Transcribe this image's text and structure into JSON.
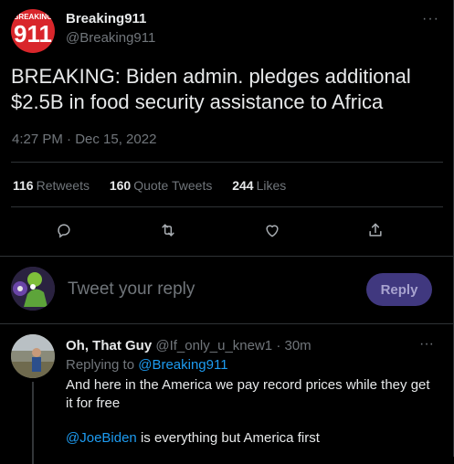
{
  "tweet": {
    "author": {
      "name": "Breaking911",
      "handle": "@Breaking911",
      "avatar_top_text": "BREAKING",
      "avatar_number": "911"
    },
    "text": "BREAKING: Biden admin. pledges additional $2.5B in food security assistance to Africa",
    "timestamp": "4:27 PM · Dec 15, 2022",
    "stats": {
      "retweets_count": "116",
      "retweets_label": "Retweets",
      "quotes_count": "160",
      "quotes_label": "Quote Tweets",
      "likes_count": "244",
      "likes_label": "Likes"
    },
    "more_icon": "···"
  },
  "compose": {
    "placeholder": "Tweet your reply",
    "button": "Reply"
  },
  "reply": {
    "name": "Oh, That Guy",
    "handle": "@If_only_u_knew1",
    "time": "30m",
    "separator": "·",
    "replying_prefix": "Replying to ",
    "replying_to": "@Breaking911",
    "text": "And here in the America we pay record prices while they get it for free",
    "mention": "@JoeBiden",
    "text2": " is everything but America first"
  },
  "colors": {
    "accent": "#1d9bf0",
    "reply_button_bg": "#40387f",
    "brand_red": "#d9262b"
  },
  "icons": [
    "comment-icon",
    "retweet-icon",
    "like-icon",
    "share-icon",
    "more-icon"
  ]
}
